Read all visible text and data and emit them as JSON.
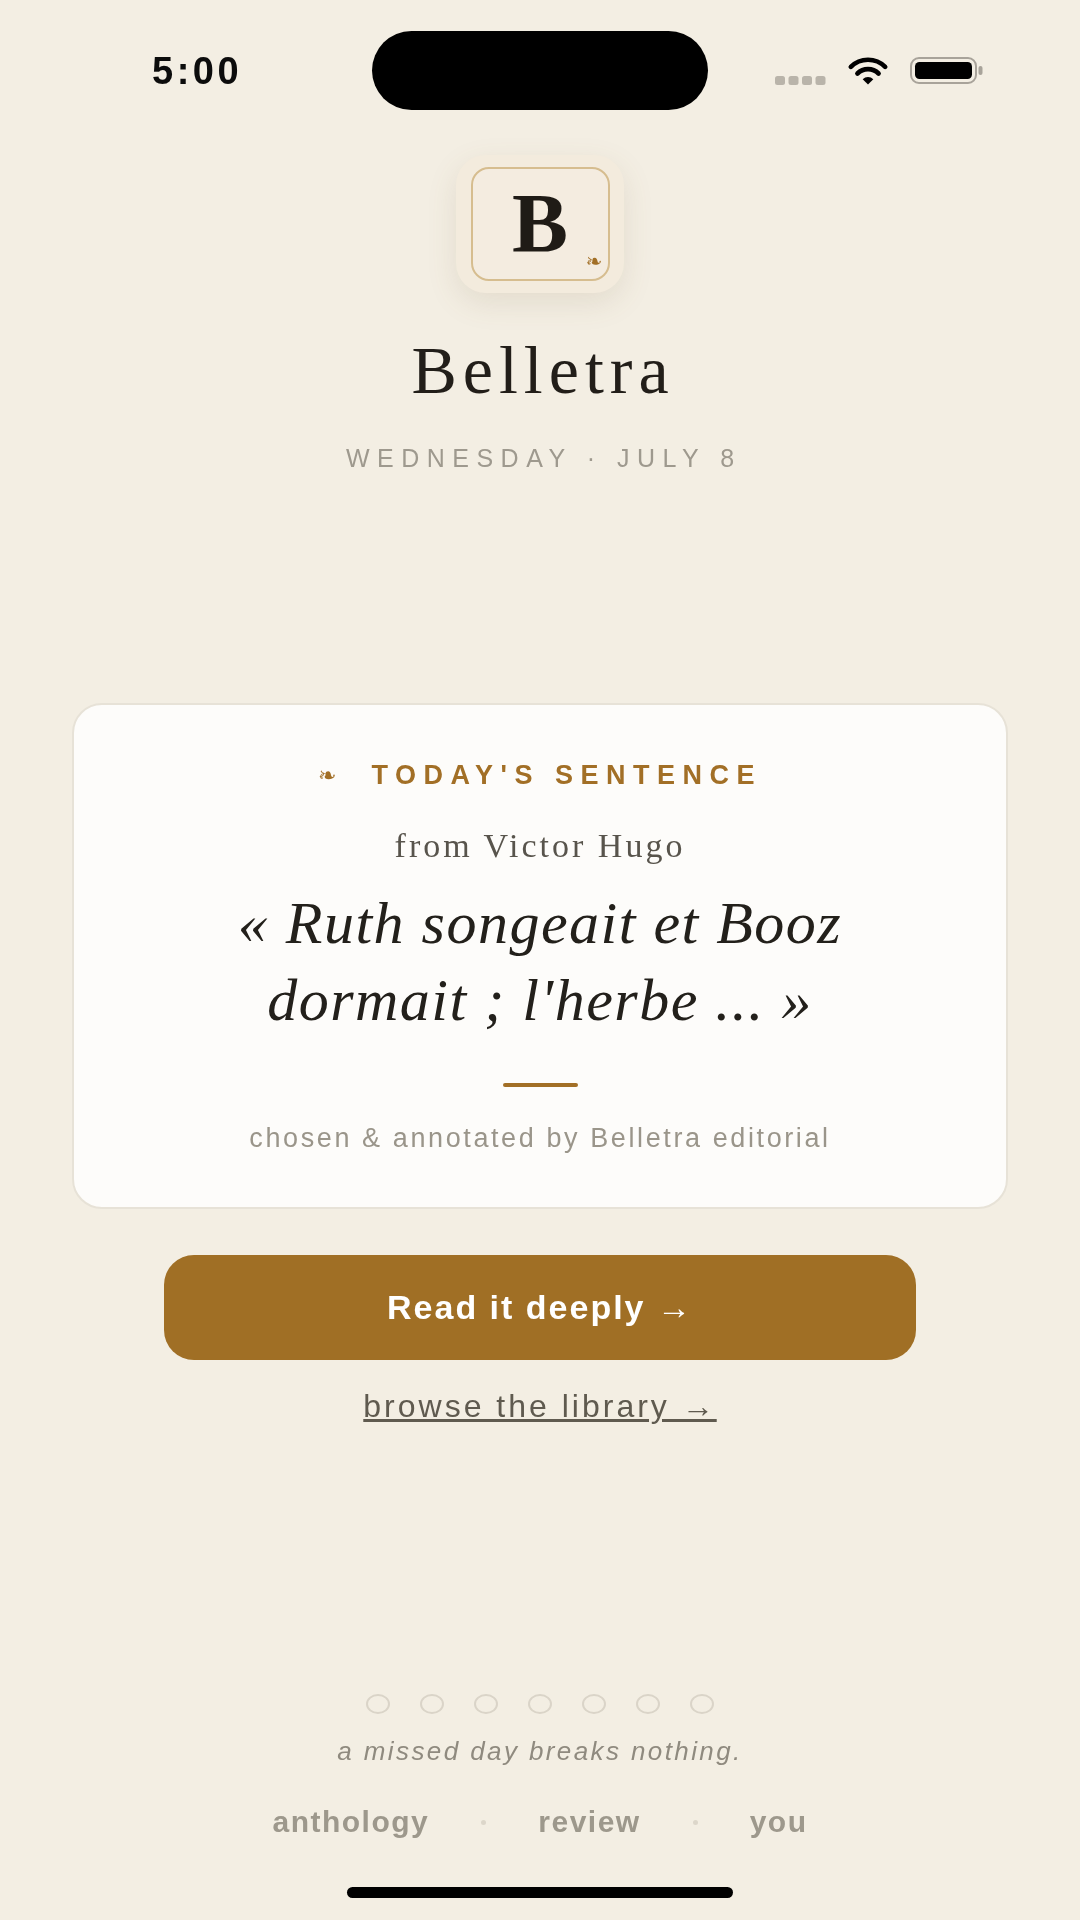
{
  "status_bar": {
    "time": "5:00"
  },
  "logo": {
    "letter": "B",
    "ornament": "❧"
  },
  "app_title": "Belletra",
  "date": "WEDNESDAY · JULY 8",
  "sentence_card": {
    "ornament": "❧",
    "heading": "TODAY'S SENTENCE",
    "source": "from Victor Hugo",
    "quote": "« Ruth songeait et Booz dormait ; l'herbe ... »",
    "credit": "chosen & annotated by Belletra editorial"
  },
  "primary_button": {
    "label": "Read it deeply →"
  },
  "secondary_link": {
    "label": "browse the library →"
  },
  "streak": {
    "days": [
      {
        "done": false
      },
      {
        "done": false
      },
      {
        "done": false
      },
      {
        "done": false
      },
      {
        "done": false
      },
      {
        "done": false
      },
      {
        "done": false
      }
    ],
    "caption": "a missed day breaks nothing."
  },
  "nav": {
    "items": [
      {
        "label": "anthology",
        "selected": false
      },
      {
        "label": "review",
        "selected": false
      },
      {
        "label": "you",
        "selected": false
      }
    ]
  }
}
